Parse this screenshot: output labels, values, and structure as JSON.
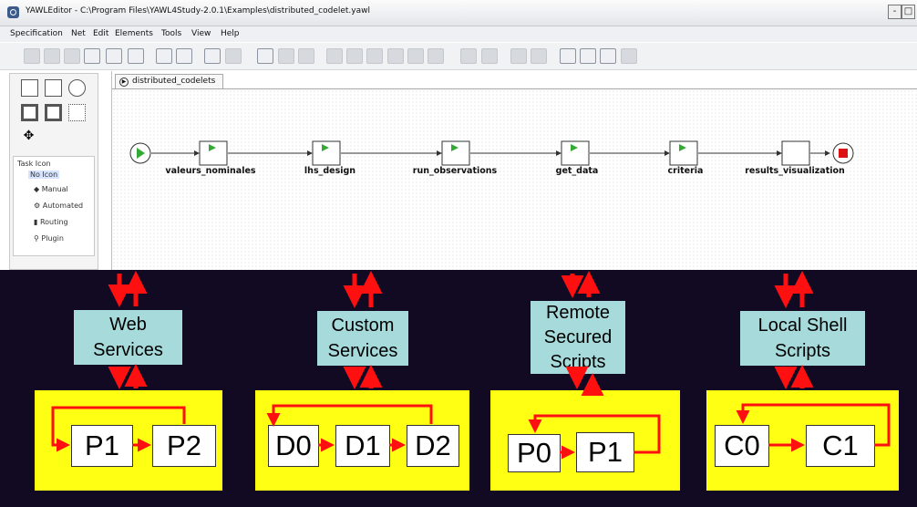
{
  "window": {
    "title": "YAWLEditor - C:\\Program Files\\YAWL4Study-2.0.1\\Examples\\distributed_codelet.yawl",
    "controls": {
      "minimize": "-",
      "maximize": "□"
    }
  },
  "menubar": [
    "Specification",
    "Net",
    "Edit",
    "Elements",
    "Tools",
    "View",
    "Help"
  ],
  "icons": {
    "app": "yawl-logo-icon",
    "toolbar": [
      "new-icon",
      "open-icon",
      "save-as-icon",
      "save-icon",
      "close-icon",
      "print-icon",
      "validate-icon",
      "preview-icon",
      "new-net-icon",
      "delete-net-icon",
      "undo-icon",
      "redo-icon",
      "delete-icon",
      "align-top-icon",
      "align-middle-icon",
      "align-bottom-icon",
      "align-left-icon",
      "align-center-icon",
      "align-right-icon",
      "cancel-set-icon",
      "remove-cancel-set-icon",
      "increase-size-icon",
      "decrease-size-icon",
      "zoom-actual-icon",
      "zoom-out-icon",
      "zoom-in-icon",
      "zoom-fit-icon"
    ],
    "palette": [
      "condition-icon",
      "atomic-task-icon",
      "multi-instance-task-icon",
      "composite-task-icon",
      "multi-composite-task-icon",
      "marquee-icon",
      "drag-icon"
    ]
  },
  "palette": {
    "task_icon_title": "Task Icon",
    "tree": [
      "No Icon",
      "Manual",
      "Automated",
      "Routing",
      "Plugin"
    ]
  },
  "editor": {
    "tab_label": "distributed_codelets",
    "tasks": [
      "valeurs_nominales",
      "lhs_design",
      "run_observations",
      "get_data",
      "criteria",
      "results_visualization"
    ]
  },
  "services": [
    {
      "lines": [
        "Web",
        "Services"
      ],
      "processes": [
        "P1",
        "P2"
      ]
    },
    {
      "lines": [
        "Custom",
        "Services"
      ],
      "processes": [
        "D0",
        "D1",
        "D2"
      ]
    },
    {
      "lines": [
        "Remote",
        "Secured",
        "Scripts"
      ],
      "processes": [
        "P0",
        "P1"
      ]
    },
    {
      "lines": [
        "Local Shell",
        "Scripts"
      ],
      "processes": [
        "C0",
        "C1"
      ]
    }
  ],
  "colors": {
    "bottom_background": "#120a22",
    "service_box": "#a6dadb",
    "process_area": "#ffff14",
    "arrow": "#ff1010",
    "start_condition": "#33aa33",
    "end_condition": "#dd1111"
  }
}
